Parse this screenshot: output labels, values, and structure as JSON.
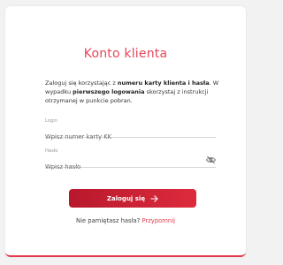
{
  "header": {
    "title": "Konto klienta"
  },
  "intro": {
    "part1": "Zaloguj się korzystając z ",
    "bold1": "numeru karty klienta i hasła",
    "part2": ". W wypadku ",
    "bold2": "pierwszego logowania",
    "part3": " skorzystaj z instrukcji otrzymanej w punkcie pobran."
  },
  "login_field": {
    "label": "Login",
    "placeholder": "Wpisz numer karty KK",
    "value": ""
  },
  "password_field": {
    "label": "Hasło",
    "placeholder": "Wpisz hasło",
    "value": ""
  },
  "submit": {
    "label": "Zaloguj się"
  },
  "forgot": {
    "question": "Nie pamiętasz hasła?",
    "link": "Przypomnij"
  },
  "colors": {
    "accent": "#e5394a",
    "button_start": "#b8182c",
    "button_end": "#dd2b3d"
  },
  "icons": {
    "password_toggle": "eye-off-icon",
    "submit_arrow": "arrow-right-icon"
  }
}
